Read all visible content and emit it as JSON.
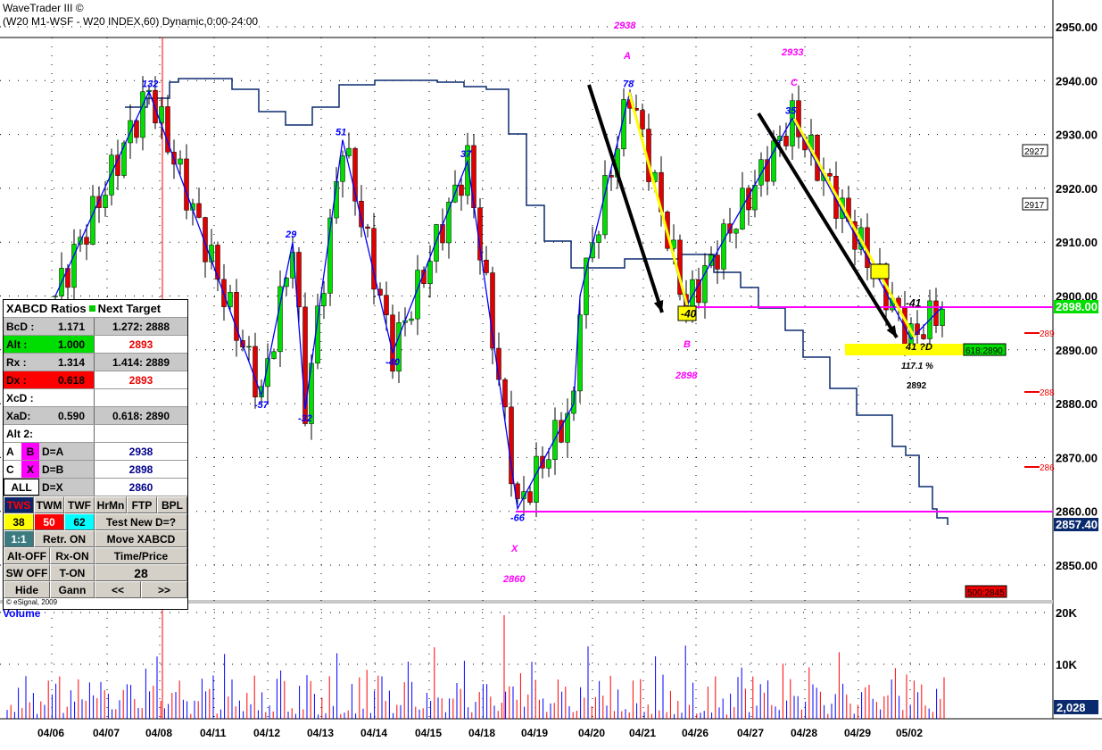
{
  "header": {
    "title": "WaveTrader III ©",
    "subtitle": "(W20 M1-WSF - W20 INDEX,60) Dynamic,0:00-24:00"
  },
  "panel": {
    "header": "XABCD Ratios",
    "header2": "Next Target",
    "rows": [
      {
        "label": "BcD :",
        "value": "1.171",
        "target": "1.272: 2888"
      },
      {
        "label": "Alt  :",
        "value": "1.000",
        "target": "2893"
      },
      {
        "label": "Rx  :",
        "value": "1.314",
        "target": "1.414: 2889"
      },
      {
        "label": "Dx  :",
        "value": "0.618",
        "target": "2893"
      },
      {
        "label": "XcD :",
        "value": "",
        "target": ""
      },
      {
        "label": "XaD:",
        "value": "0.590",
        "target": "0.618: 2890"
      },
      {
        "label": "Alt 2:",
        "value": "",
        "target": ""
      }
    ],
    "alt2": [
      {
        "a": "A",
        "b": "B",
        "eq": "D=A",
        "val": "2938"
      },
      {
        "a": "C",
        "b": "X",
        "eq": "D=B",
        "val": "2898"
      },
      {
        "a": "ALL",
        "b": "",
        "eq": "D=X",
        "val": "2860"
      }
    ],
    "buttons": {
      "tws": "TWS",
      "twm": "TWM",
      "twf": "TWF",
      "hrmn": "HrMn",
      "ftp": "FTP",
      "bpl": "BPL",
      "b38": "38",
      "b50": "50",
      "b62": "62",
      "test": "Test New D=?",
      "r11": "1:1",
      "retr": "Retr. ON",
      "move": "Move XABCD",
      "altoff": "Alt-OFF",
      "rxon": "Rx-ON",
      "timeprice": "Time/Price",
      "swoff": "SW OFF",
      "ton": "T-ON",
      "n28": "28",
      "hide": "Hide",
      "gann": "Gann",
      "prev": "<<",
      "next": ">>"
    },
    "copyright": "© eSignal, 2009"
  },
  "chart_data": {
    "type": "candlestick",
    "title": "W20 INDEX,60",
    "ylim": [
      2845,
      2952
    ],
    "yticks": [
      "2950.00",
      "2940.00",
      "2930.00",
      "2920.00",
      "2910.00",
      "2900.00",
      "2890.00",
      "2880.00",
      "2870.00",
      "2860.00",
      "2850.00"
    ],
    "ytick_values": [
      2950,
      2940,
      2930,
      2920,
      2910,
      2900,
      2890,
      2880,
      2870,
      2860,
      2850
    ],
    "xticks": [
      "04/06",
      "04/07",
      "04/08",
      "04/11",
      "04/12",
      "04/13",
      "04/14",
      "04/15",
      "04/18",
      "04/19",
      "04/20",
      "04/21",
      "04/26",
      "04/27",
      "04/28",
      "04/29",
      "05/02"
    ],
    "swing_points": [
      {
        "bar": 0,
        "price": 2900,
        "label": ""
      },
      {
        "bar": 15,
        "price": 2938,
        "label": "132"
      },
      {
        "bar": 33,
        "price": 2881.5,
        "label": "-57"
      },
      {
        "bar": 38,
        "price": 2910,
        "label": "29"
      },
      {
        "bar": 40,
        "price": 2879,
        "label": "-32"
      },
      {
        "bar": 46,
        "price": 2929,
        "label": "51"
      },
      {
        "bar": 54,
        "price": 2889.5,
        "label": "-40"
      },
      {
        "bar": 66,
        "price": 2925,
        "label": "37"
      },
      {
        "bar": 74,
        "price": 2860.5,
        "label": "-66"
      },
      {
        "bar": 83,
        "price": 2880,
        "label": ""
      },
      {
        "bar": 84,
        "price": 2900,
        "label": ""
      },
      {
        "bar": 92,
        "price": 2938,
        "label": "78"
      },
      {
        "bar": 101,
        "price": 2898,
        "label": "-40"
      },
      {
        "bar": 118,
        "price": 2933,
        "label": "35"
      },
      {
        "bar": 137,
        "price": 2892,
        "label": "-41"
      },
      {
        "bar": 142,
        "price": 2898,
        "label": ""
      }
    ],
    "pattern_labels": {
      "A": "A",
      "A_price": "2938",
      "B": "B",
      "B_price": "2898",
      "C": "C",
      "C_price": "2933",
      "X": "X",
      "X_price": "2860",
      "D": "41 ?D",
      "pct": "117.1 %",
      "d_price": "2892"
    },
    "last_price": "2898.00",
    "indicator_last": "2857.40",
    "side_boxes": [
      "2927",
      "2917"
    ],
    "red_ticks": [
      "289",
      "288",
      "286"
    ],
    "target_boxes": {
      "fib": "618:2890",
      "low": "500:2845"
    },
    "volume": {
      "label": "Volume",
      "yticks": [
        "20K",
        "10K"
      ],
      "last": "2,028",
      "ylim": [
        0,
        20000
      ]
    },
    "colors": {
      "up": "#00e000",
      "down": "#e00000",
      "swing": "#0000ff",
      "indicator": "#0a2a6e",
      "magenta": "#ff00ff"
    }
  }
}
